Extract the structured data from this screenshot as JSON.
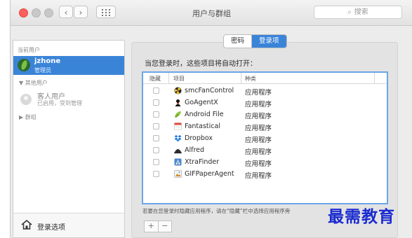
{
  "window": {
    "title": "用户与群组",
    "search_placeholder": "搜索",
    "nav_back": "‹",
    "nav_forward": "›"
  },
  "tabs": [
    {
      "label": "密码",
      "active": false
    },
    {
      "label": "登录项",
      "active": true
    }
  ],
  "sidebar": {
    "current_user_header": "当前用户",
    "current_user": {
      "name": "jzhone",
      "role": "管理员"
    },
    "other_users_header": "▼ 其他用户",
    "guest": {
      "name": "客人用户",
      "status": "已启用，受到管理"
    },
    "groups_header": "▶ 群组",
    "login_options_label": "登录选项"
  },
  "main": {
    "prompt": "当您登录时，这些项目将自动打开：",
    "columns": [
      "隐藏",
      "项目",
      "种类"
    ],
    "items": [
      {
        "name": "smcFanControl",
        "kind": "应用程序",
        "icon": "smcfancontrol-icon",
        "hidden": false
      },
      {
        "name": "GoAgentX",
        "kind": "应用程序",
        "icon": "goagentx-icon",
        "hidden": false
      },
      {
        "name": "Android File",
        "kind": "应用程序",
        "icon": "android-file-icon",
        "hidden": false
      },
      {
        "name": "Fantastical",
        "kind": "应用程序",
        "icon": "fantastical-icon",
        "hidden": false
      },
      {
        "name": "Dropbox",
        "kind": "应用程序",
        "icon": "dropbox-icon",
        "hidden": false
      },
      {
        "name": "Alfred",
        "kind": "应用程序",
        "icon": "alfred-icon",
        "hidden": false
      },
      {
        "name": "XtraFinder",
        "kind": "应用程序",
        "icon": "xtrafinder-icon",
        "hidden": false
      },
      {
        "name": "GIFPaperAgent",
        "kind": "应用程序",
        "icon": "gifpaperagent-icon",
        "hidden": false
      }
    ],
    "hint": "若要在您登录时隐藏应用程序，请在“隐藏”栏中选择应用程序旁",
    "add_label": "+",
    "remove_label": "−"
  },
  "watermark": "最需教育",
  "colors": {
    "accent": "#3a84d8",
    "table_focus": "#6aa6e8",
    "watermark": "#1a2bd0"
  }
}
